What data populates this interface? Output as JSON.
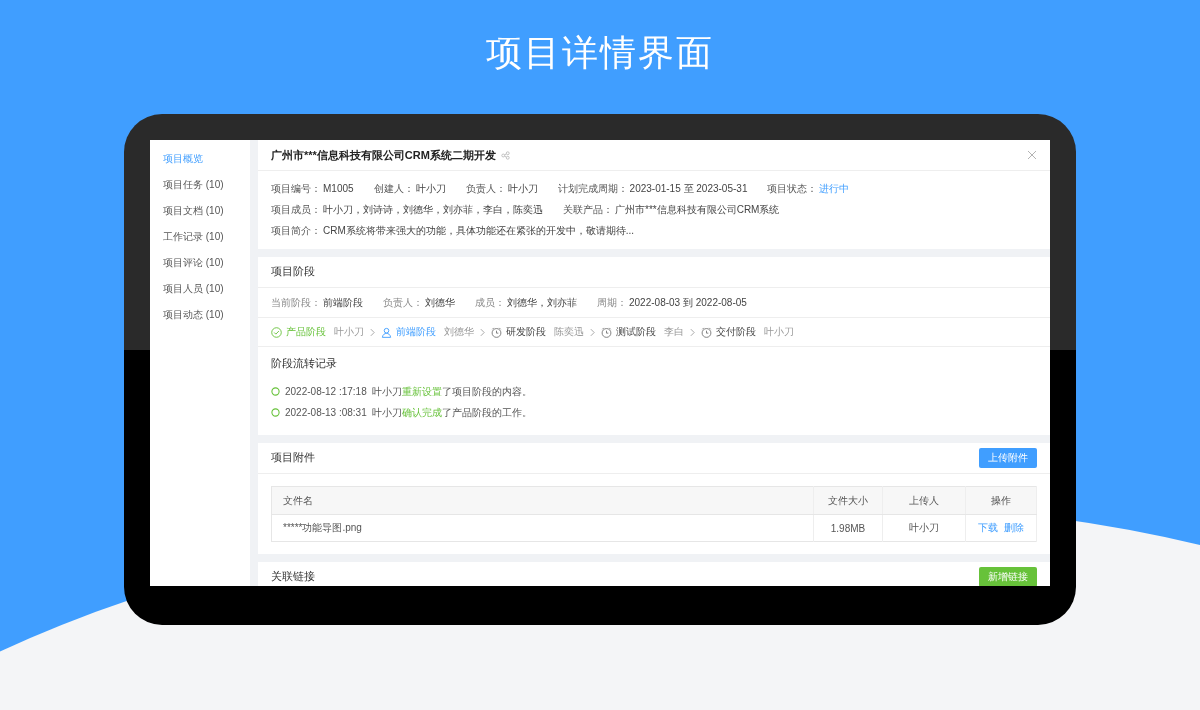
{
  "heading": "项目详情界面",
  "sidebar": {
    "items": [
      {
        "label": "项目概览",
        "selected": true
      },
      {
        "label": "项目任务 (10)",
        "selected": false
      },
      {
        "label": "项目文档 (10)",
        "selected": false
      },
      {
        "label": "工作记录 (10)",
        "selected": false
      },
      {
        "label": "项目评论 (10)",
        "selected": false
      },
      {
        "label": "项目人员 (10)",
        "selected": false
      },
      {
        "label": "项目动态 (10)",
        "selected": false
      }
    ]
  },
  "project": {
    "title": "广州市***信息科技有限公司CRM系统二期开发",
    "info_rows": [
      [
        {
          "label": "项目编号：",
          "value": "M1005",
          "kind": "text"
        },
        {
          "label": "创建人：",
          "value": "叶小刀",
          "kind": "text"
        },
        {
          "label": "负责人：",
          "value": "叶小刀",
          "kind": "text"
        },
        {
          "label": "计划完成周期：",
          "value": "2023-01-15 至  2023-05-31",
          "kind": "text"
        },
        {
          "label": "项目状态：",
          "value": "进行中",
          "kind": "status"
        }
      ],
      [
        {
          "label": "项目成员：",
          "value": "叶小刀，刘诗诗，刘德华，刘亦菲，李白，陈奕迅",
          "kind": "text"
        },
        {
          "label": "关联产品：",
          "value": "广州市***信息科技有限公司CRM系统",
          "kind": "text"
        }
      ],
      [
        {
          "label": "项目简介：",
          "value": "CRM系统将带来强大的功能，具体功能还在紧张的开发中，敬请期待...",
          "kind": "text"
        }
      ]
    ]
  },
  "stages": {
    "title": "项目阶段",
    "meta": [
      {
        "label": "当前阶段：",
        "value": "前端阶段"
      },
      {
        "label": "负责人：",
        "value": "刘德华"
      },
      {
        "label": "成员：",
        "value": "刘德华，刘亦菲"
      },
      {
        "label": "周期：",
        "value": "2022-08-03 到 2022-08-05"
      }
    ],
    "steps": [
      {
        "name": "产品阶段",
        "person": "叶小刀",
        "done": true,
        "selected": false
      },
      {
        "name": "前端阶段",
        "person": "刘德华",
        "done": false,
        "selected": true
      },
      {
        "name": "研发阶段",
        "person": "陈奕迅",
        "done": false,
        "selected": false
      },
      {
        "name": "测试阶段",
        "person": "李白",
        "done": false,
        "selected": false
      },
      {
        "name": "交付阶段",
        "person": "叶小刀",
        "done": false,
        "selected": false
      }
    ],
    "log_title": "阶段流转记录",
    "log": [
      {
        "time": "2022-08-12 :17:18",
        "user": "叶小刀",
        "action": "重新设置",
        "rest": "了项目阶段的内容。"
      },
      {
        "time": "2022-08-13 :08:31",
        "user": "叶小刀",
        "action": "确认完成",
        "rest": "了产品阶段的工作。"
      }
    ]
  },
  "attachments": {
    "title": "项目附件",
    "button": "上传附件",
    "columns": [
      "文件名",
      "文件大小",
      "上传人",
      "操作"
    ],
    "rows": [
      {
        "cells": [
          "*****功能导图.png",
          "1.98MB",
          "叶小刀"
        ],
        "actions": [
          "下载",
          "删除"
        ]
      }
    ]
  },
  "links": {
    "title": "关联链接",
    "button": "新增链接"
  }
}
